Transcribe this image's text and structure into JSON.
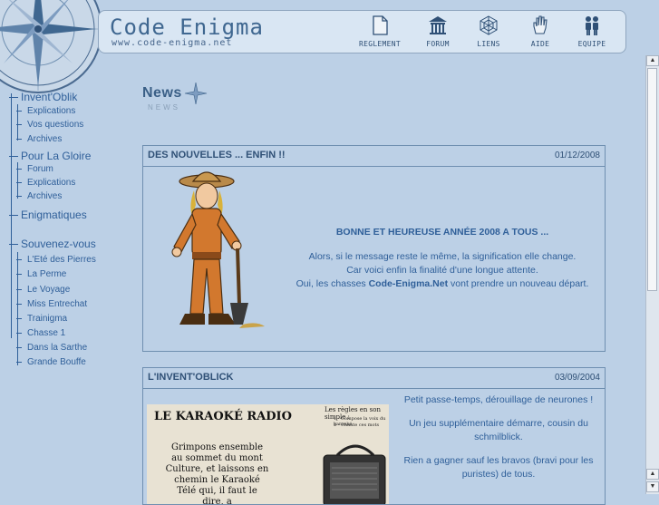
{
  "header": {
    "title": "Code Enigma",
    "url": "www.code-enigma.net",
    "nav": [
      {
        "label": "REGLEMENT",
        "icon": "document-icon"
      },
      {
        "label": "FORUM",
        "icon": "building-icon"
      },
      {
        "label": "LIENS",
        "icon": "web-icon"
      },
      {
        "label": "AIDE",
        "icon": "hand-icon"
      },
      {
        "label": "EQUIPE",
        "icon": "people-icon"
      }
    ]
  },
  "sidebar": {
    "sections": [
      {
        "label": "Invent'Oblik",
        "items": [
          "Explications",
          "Vos questions",
          "Archives"
        ]
      },
      {
        "label": "Pour La Gloire",
        "items": [
          "Forum",
          "Explications",
          "Archives"
        ]
      },
      {
        "label": "Enigmatiques",
        "items": []
      },
      {
        "label": "Souvenez-vous",
        "items": [
          "L'Eté des Pierres",
          "La Perme",
          "Le Voyage",
          "Miss Entrechat",
          "Trainigma",
          "Chasse 1",
          "Dans la Sarthe",
          "Grande Bouffe"
        ]
      }
    ]
  },
  "news": {
    "title": "News",
    "subtitle": "NEWS"
  },
  "posts": [
    {
      "title": "DES NOUVELLES ... ENFIN !!",
      "date": "01/12/2008",
      "headline": "BONNE ET HEUREUSE ANNÉE 2008 A TOUS ...",
      "line1": "Alors, si le message reste le même, la signification elle change.",
      "line2": "Car voici enfin la finalité d'une longue attente.",
      "line3_pre": "Oui, les chasses ",
      "line3_bold": "Code-Enigma.Net",
      "line3_post": " vont prendre un nouveau départ."
    },
    {
      "title": "L'INVENT'OBLICK",
      "date": "03/09/2004",
      "p1": "Petit passe-temps, dérouillage de neurones !",
      "p2": "Un jeu supplémentaire démarre, cousin du schmilblick.",
      "p3": "Rien a gagner sauf les bravos (bravi pour les puristes) de tous.",
      "image": {
        "heading": "LE KARAOKÉ RADIO",
        "rules_title": "Les règles en son simple :",
        "rule1": "1 - Compose la voix du karaoké",
        "rule2": "2 - Chante ces mots",
        "body": "Grimpons ensemble au sommet du mont Culture, et laissons en chemin le Karaoké Télé qui, il faut le dire, a"
      }
    }
  ],
  "colors": {
    "background": "#bcd0e6",
    "accent": "#2f5f99",
    "border": "#6f8fb0"
  }
}
